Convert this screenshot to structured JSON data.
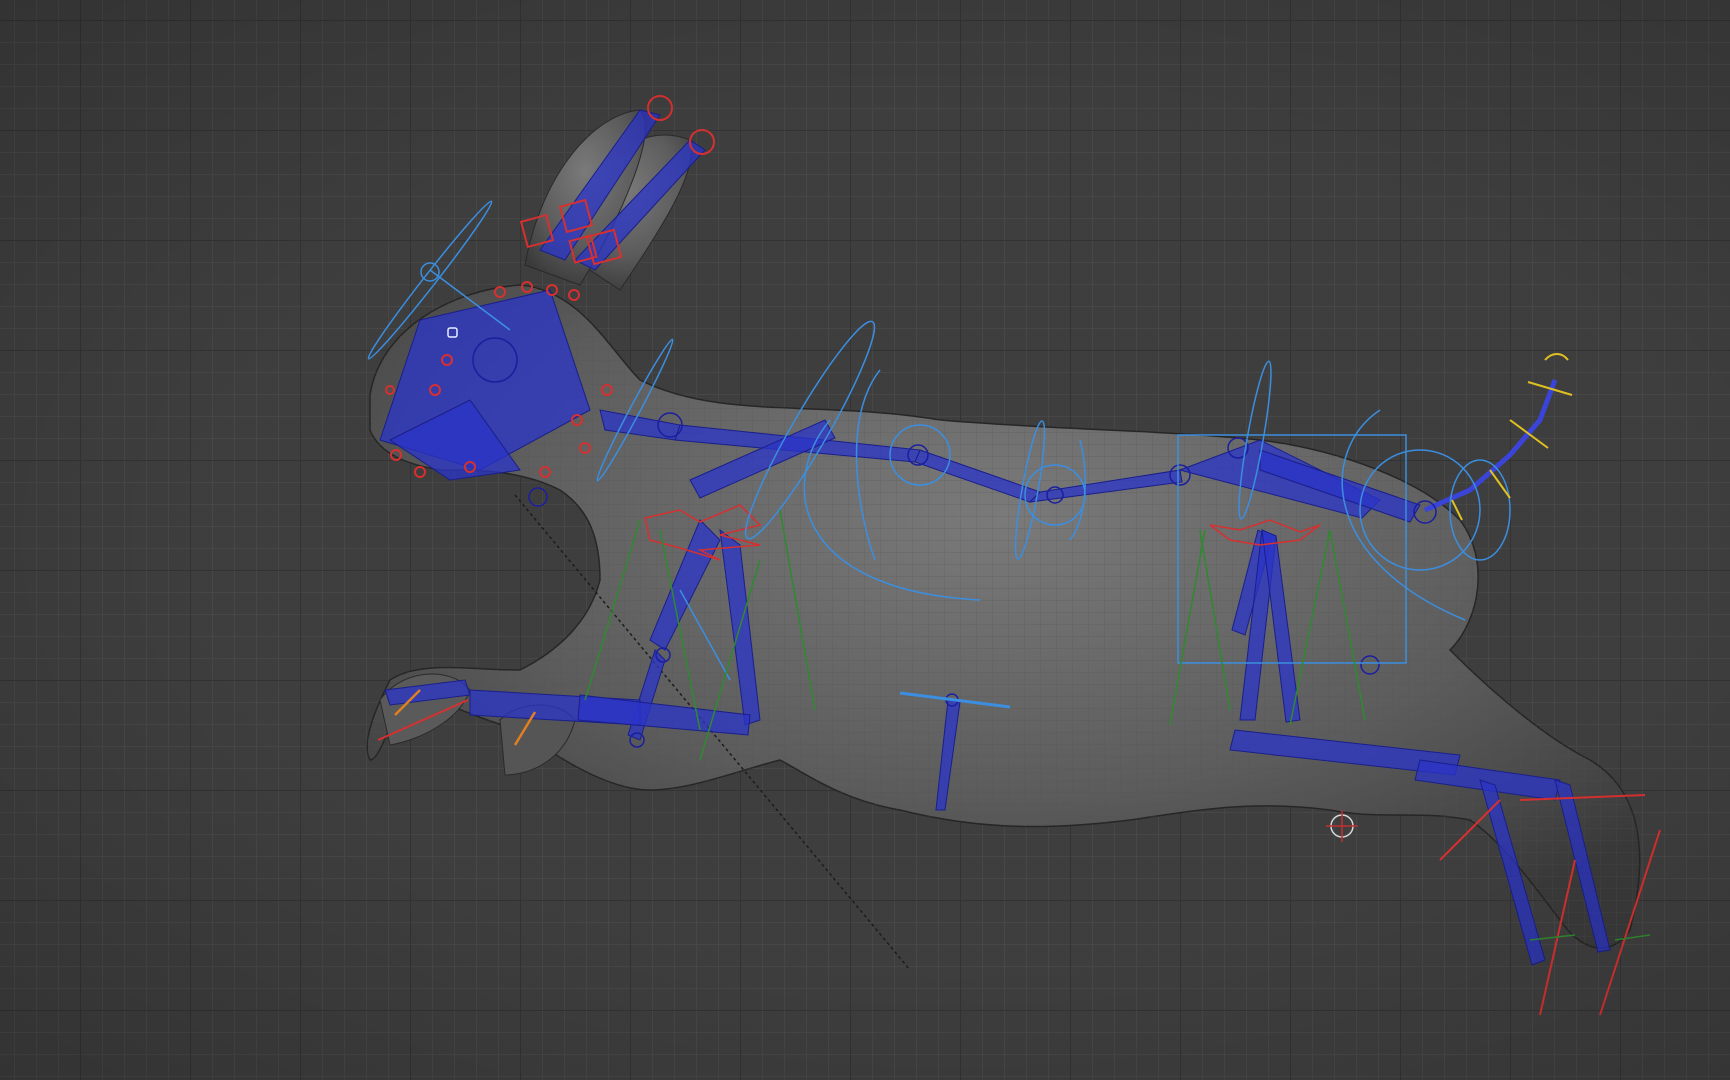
{
  "viewport": {
    "grid_color": "#474747",
    "grid_major_color": "#333333",
    "background_color": "#3e3e3e"
  },
  "colors": {
    "mesh": "#6a6a6a",
    "wire": "#4e4e4e",
    "joint": "#2730b8",
    "ik_control": "#3a88d8",
    "face_control": "#d03030",
    "pole_vector": "#2f8a2f",
    "tail_control": "#e0c020",
    "foot_control": "#e08020"
  },
  "scene": {
    "object": "rabbit-rig",
    "icons": [
      "pivot-crosshair-icon",
      "camera-icon"
    ]
  }
}
